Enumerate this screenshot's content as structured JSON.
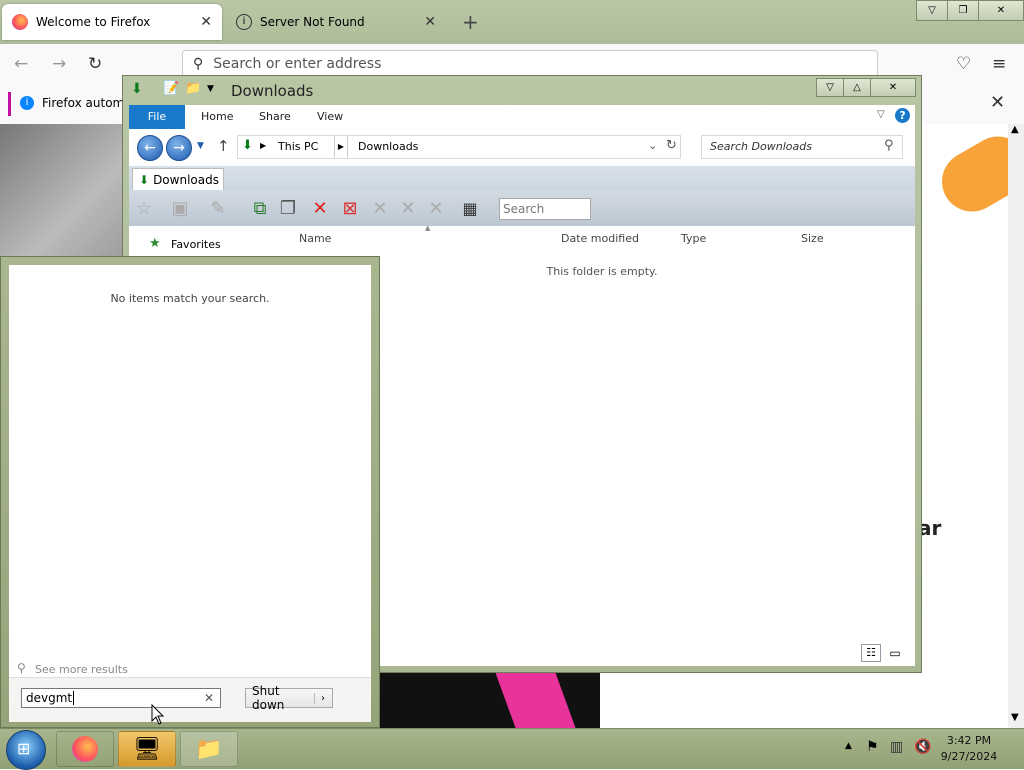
{
  "firefox": {
    "tabs": [
      {
        "label": "Welcome to Firefox"
      },
      {
        "label": "Server Not Found"
      }
    ],
    "url_placeholder": "Search or enter address",
    "notification": "Firefox automati",
    "content_fragment": "ar"
  },
  "explorer": {
    "title": "Downloads",
    "ribbon_tabs": [
      "File",
      "Home",
      "Share",
      "View"
    ],
    "breadcrumb": [
      "This PC",
      "Downloads"
    ],
    "search_placeholder": "Search Downloads",
    "tab_label": "Downloads",
    "toolbar_search": "Search",
    "nav": {
      "favorites": "Favorites"
    },
    "columns": [
      "Name",
      "Date modified",
      "Type",
      "Size"
    ],
    "empty_message": "This folder is empty."
  },
  "start_menu": {
    "no_results": "No items match your search.",
    "see_more": "See more results",
    "search_value": "devgmt",
    "shutdown_label": "Shut down"
  },
  "taskbar": {
    "time": "3:42 PM",
    "date": "9/27/2024"
  }
}
